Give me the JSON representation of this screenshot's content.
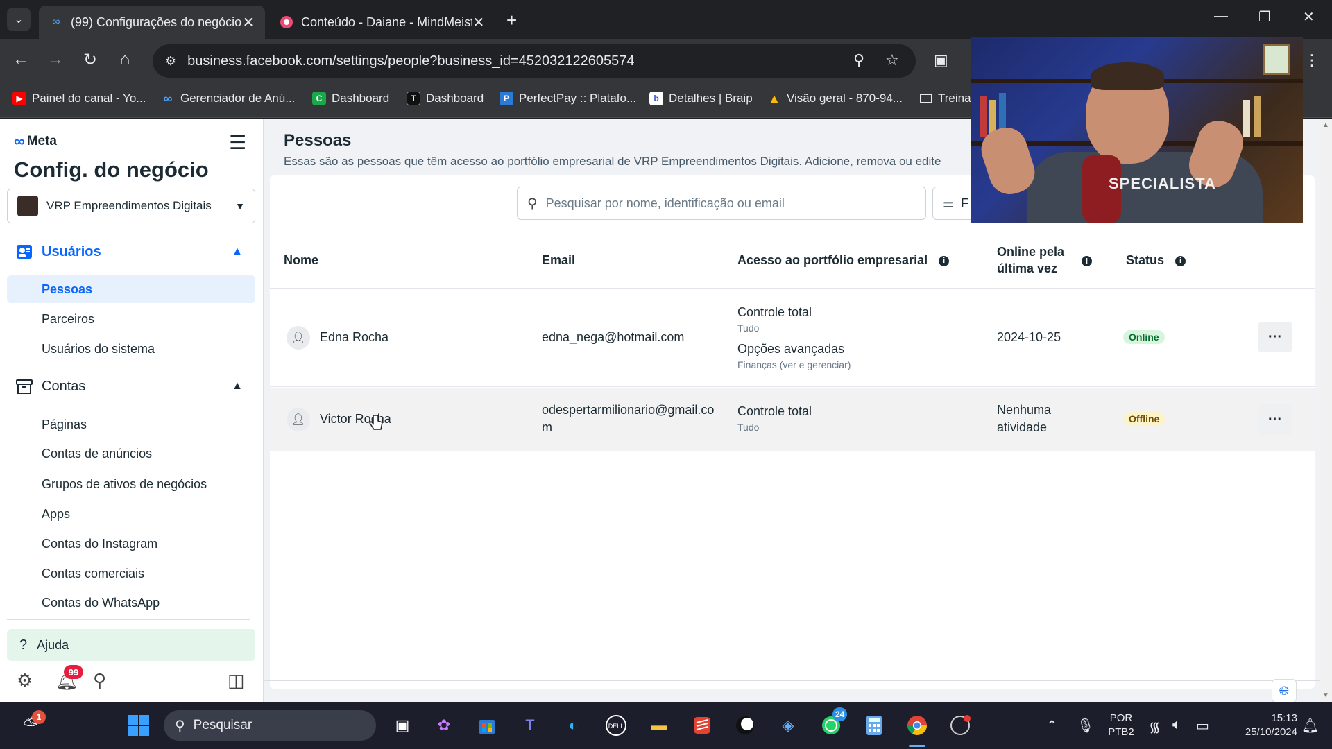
{
  "browser": {
    "tabs": [
      {
        "title": "(99) Configurações do negócio",
        "close": "✕"
      },
      {
        "title": "Conteúdo - Daiane - MindMeist",
        "close": "✕"
      }
    ],
    "new_tab": "+",
    "url": "business.facebook.com/settings/people?business_id=452032122605574",
    "bookmarks": [
      "Painel do canal - Yo...",
      "Gerenciador de Anú...",
      "Dashboard",
      "Dashboard",
      "PerfectPay :: Platafo...",
      "Detalhes | Braip",
      "Visão geral - 870-94...",
      "Treina"
    ]
  },
  "sidebar": {
    "logo": "Meta",
    "app_title": "Config. do negócio",
    "business": "VRP Empreendimentos Digitais",
    "sections": [
      {
        "label": "Usuários",
        "items": [
          "Pessoas",
          "Parceiros",
          "Usuários do sistema"
        ]
      },
      {
        "label": "Contas",
        "items": [
          "Páginas",
          "Contas de anúncios",
          "Grupos de ativos de negócios",
          "Apps",
          "Contas do Instagram",
          "Contas comerciais",
          "Contas do WhatsApp"
        ]
      }
    ],
    "help": "Ajuda",
    "notif_count": "99"
  },
  "main": {
    "title": "Pessoas",
    "description": "Essas são as pessoas que têm acesso ao portfólio empresarial de VRP Empreendimentos Digitais. Adicione, remova ou edite",
    "search_placeholder": "Pesquisar por nome, identificação ou email",
    "filter_label": "F",
    "columns": [
      "Nome",
      "Email",
      "Acesso ao portfólio empresarial",
      "Online pela última vez",
      "Status"
    ],
    "rows": [
      {
        "name": "Edna Rocha",
        "email": "edna_nega@hotmail.com",
        "access": [
          {
            "title": "Controle total",
            "detail": "Tudo"
          },
          {
            "title": "Opções avançadas",
            "detail": "Finanças (ver e gerenciar)"
          }
        ],
        "last_online": "2024-10-25",
        "status": "Online"
      },
      {
        "name": "Victor Rocha",
        "email": "odespertarmilionario@gmail.com",
        "access": [
          {
            "title": "Controle total",
            "detail": "Tudo"
          }
        ],
        "last_online": "Nenhuma atividade",
        "status": "Offline"
      }
    ],
    "more_label": "···"
  },
  "webcam": {
    "shirt_text": "SPECIALISTA"
  },
  "taskbar": {
    "search_label": "Pesquisar",
    "whatsapp_badge": "24",
    "weather_badge": "1",
    "lang": "POR",
    "layout": "PTB2",
    "time": "15:13",
    "date": "25/10/2024"
  },
  "colors": {
    "accent": "#0866ff",
    "online_badge": "#d7f5dc",
    "offline_badge": "#fdf3c8"
  }
}
